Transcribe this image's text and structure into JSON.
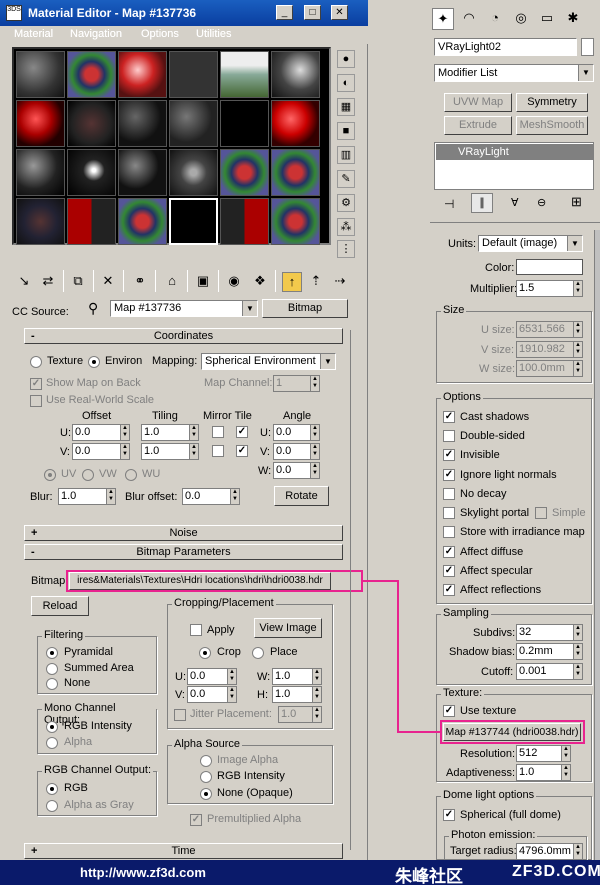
{
  "window": {
    "title": "Material Editor - Map #137736",
    "app_icon_text": "3DS"
  },
  "menu": [
    "Material",
    "Navigation",
    "Options",
    "Utilities"
  ],
  "cc_source": {
    "label": "CC Source:",
    "map_name": "Map #137736",
    "type_button": "Bitmap"
  },
  "rollouts": {
    "coordinates": "Coordinates",
    "noise": "Noise",
    "bitmap_params": "Bitmap Parameters",
    "time": "Time",
    "sign_open": "-",
    "sign_closed": "+"
  },
  "coordinates": {
    "texture": "Texture",
    "environ": "Environ",
    "mapping_label": "Mapping:",
    "mapping_value": "Spherical Environment",
    "show_map_on_back": "Show Map on Back",
    "map_channel_label": "Map Channel:",
    "map_channel_value": "1",
    "use_real_world_scale": "Use Real-World Scale",
    "offset_header": "Offset",
    "tiling_header": "Tiling",
    "mirror_tile_header": "Mirror Tile",
    "angle_header": "Angle",
    "u_label": "U:",
    "v_label": "V:",
    "w_label": "W:",
    "u_offset": "0.0",
    "v_offset": "0.0",
    "u_tiling": "1.0",
    "v_tiling": "1.0",
    "u_angle": "0.0",
    "v_angle": "0.0",
    "w_angle": "0.0",
    "uv": "UV",
    "vw": "VW",
    "wu": "WU",
    "blur_label": "Blur:",
    "blur_value": "1.0",
    "blur_offset_label": "Blur offset:",
    "blur_offset_value": "0.0",
    "rotate": "Rotate"
  },
  "bitmap": {
    "label": "Bitmap:",
    "path": "ires&Materials\\Textures\\Hdri locations\\hdri\\hdri0038.hdr",
    "reload": "Reload",
    "filtering": {
      "title": "Filtering",
      "pyramidal": "Pyramidal",
      "summed_area": "Summed Area",
      "none": "None"
    },
    "mono": {
      "title": "Mono Channel Output:",
      "rgb_intensity": "RGB Intensity",
      "alpha": "Alpha"
    },
    "rgb_out": {
      "title": "RGB Channel Output:",
      "rgb": "RGB",
      "alpha_as_gray": "Alpha as Gray"
    },
    "cropping": {
      "title": "Cropping/Placement",
      "apply": "Apply",
      "view_image": "View Image",
      "crop": "Crop",
      "place": "Place",
      "u_label": "U:",
      "v_label": "V:",
      "w_label": "W:",
      "h_label": "H:",
      "u": "0.0",
      "v": "0.0",
      "w": "1.0",
      "h": "1.0",
      "jitter_label": "Jitter Placement:",
      "jitter_value": "1.0"
    },
    "alpha_source": {
      "title": "Alpha Source",
      "image_alpha": "Image Alpha",
      "rgb_intensity": "RGB Intensity",
      "none_opaque": "None (Opaque)"
    },
    "premultiplied": "Premultiplied Alpha"
  },
  "cmd": {
    "object_name": "VRayLight02",
    "modifier_list": "Modifier List",
    "mod_buttons": [
      "UVW Map",
      "Symmetry",
      "Extrude",
      "MeshSmooth"
    ],
    "stack_item": "VRayLight",
    "units_label": "Units:",
    "units_value": "Default (image)",
    "color_label": "Color:",
    "multiplier_label": "Multiplier:",
    "multiplier_value": "1.5",
    "size": {
      "title": "Size",
      "u_label": "U size:",
      "u_value": "6531.566",
      "v_label": "V size:",
      "v_value": "1910.982",
      "w_label": "W size:",
      "w_value": "100.0mm"
    },
    "options": {
      "title": "Options",
      "items": [
        "Cast shadows",
        "Double-sided",
        "Invisible",
        "Ignore light normals",
        "No decay",
        "Skylight portal",
        "Store with irradiance map",
        "Affect diffuse",
        "Affect specular",
        "Affect reflections"
      ],
      "simple": "Simple"
    },
    "sampling": {
      "title": "Sampling",
      "subdivs_label": "Subdivs:",
      "subdivs_value": "32",
      "shadow_bias_label": "Shadow bias:",
      "shadow_bias_value": "0.2mm",
      "cutoff_label": "Cutoff:",
      "cutoff_value": "0.001"
    },
    "texture": {
      "title": "Texture:",
      "use_texture": "Use texture",
      "map_button": "Map #137744 (hdri0038.hdr)",
      "resolution_label": "Resolution:",
      "resolution_value": "512",
      "adaptiveness_label": "Adaptiveness:",
      "adaptiveness_value": "1.0"
    },
    "dome": {
      "title": "Dome light options",
      "spherical": "Spherical (full dome)",
      "photon_title": "Photon emission:",
      "target_radius_label": "Target radius:",
      "target_radius_value": "4796.0mm"
    }
  },
  "footer": {
    "url": "http://www.zf3d.com",
    "cn": "朱峰社区",
    "brand": "ZF3D.COM"
  },
  "colors": {
    "highlight": "#e8238f",
    "title_blue": "#0a3ea0",
    "swatch": "#ffffff"
  }
}
